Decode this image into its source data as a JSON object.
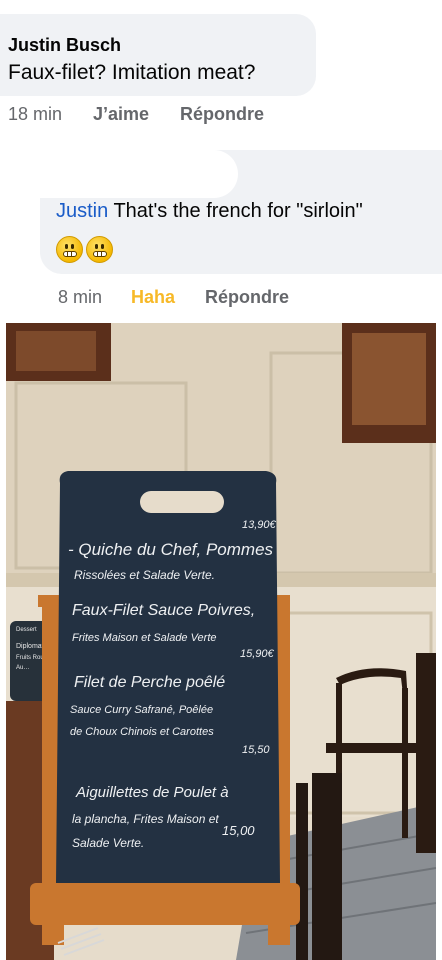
{
  "comment": {
    "author": "Justin Busch",
    "text": "Faux-filet? Imitation meat?",
    "time": "18 min",
    "like_label": "J’aime",
    "reply_label": "Répondre"
  },
  "reply": {
    "mention": "Justin",
    "text": " That's the french for \"sirloin\"",
    "emojis": [
      "grimacing-face",
      "grimacing-face"
    ],
    "time": "8 min",
    "reaction_label": "Haha",
    "reply_label": "Répondre"
  },
  "photo": {
    "board_lines": [
      "13,90€",
      "- Quiche du Chef, Pommes",
      "Rissolées et Salade Verte.",
      "Faux-Filet Sauce Poivres,",
      "Frites Maison et Salade Verte",
      "15,90€",
      "Filet de Perche poêlé",
      "Sauce Curry Safrané, Poêlée",
      "de Choux Chinois et Carottes",
      "15,50",
      "Aiguillettes de Poulet à",
      "la plancha, Frites Maison et",
      "Salade Verte.",
      "15,00"
    ],
    "side_sign_lines": [
      "Dessert",
      "Diplomate",
      "Fruits Rouges",
      "Au…"
    ]
  },
  "colors": {
    "bubble": "#f0f2f5",
    "mention": "#1a5cc8",
    "meta": "#65676b",
    "haha": "#f7b928",
    "board": "#233142",
    "frame": "#c9772f"
  }
}
